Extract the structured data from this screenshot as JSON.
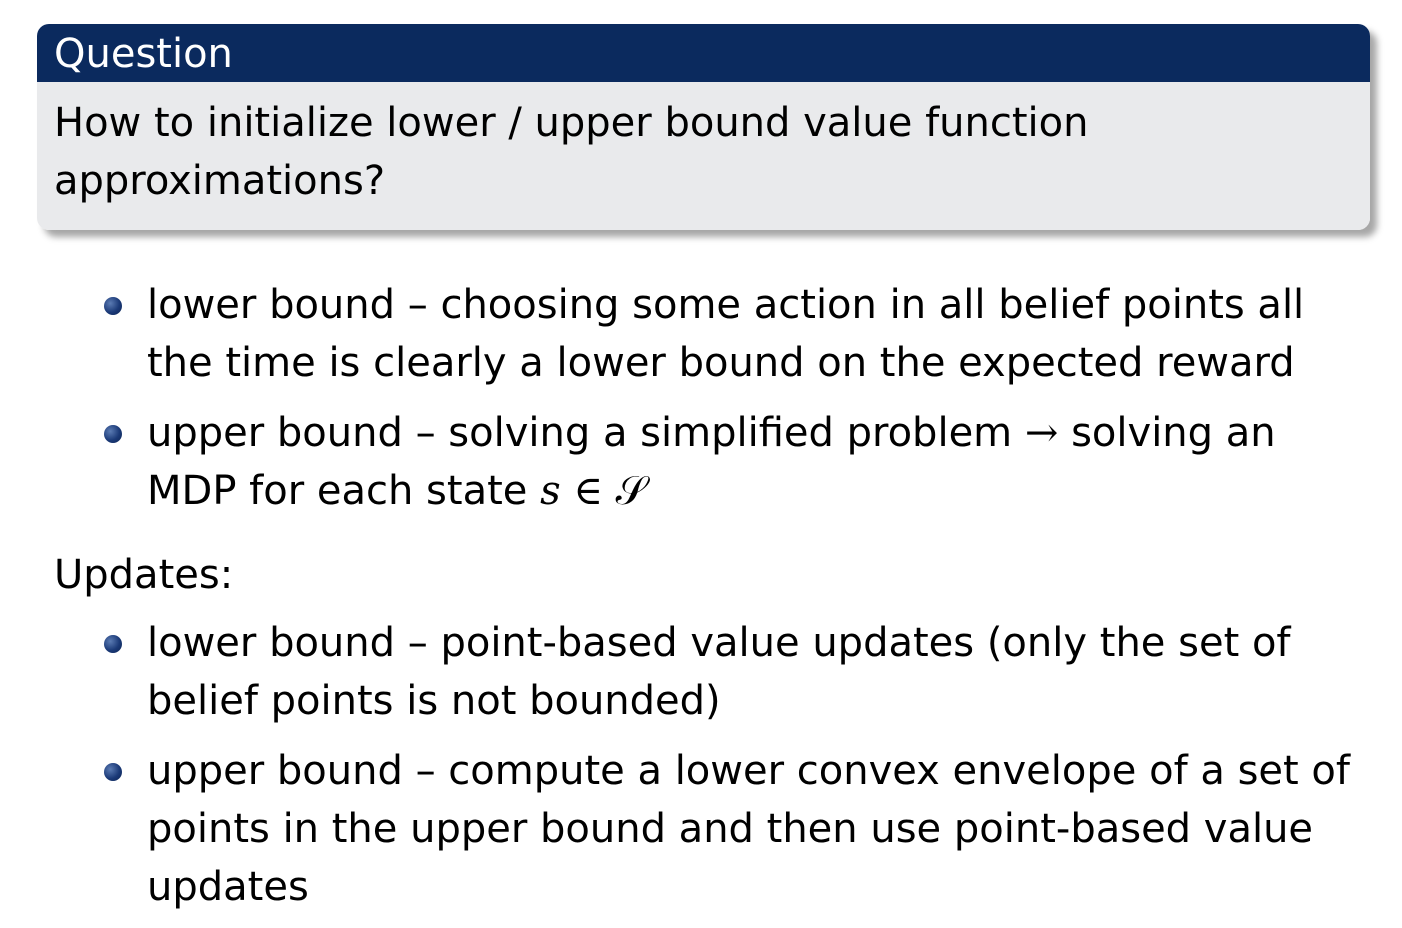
{
  "block": {
    "title": "Question",
    "body": "How to initialize lower / upper bound value function approximations?"
  },
  "init_items": [
    {
      "text": "lower bound – choosing some action in all belief points all the time is clearly a lower bound on the expected reward"
    },
    {
      "text_before": "upper bound – solving a simplified problem ",
      "arrow": "→",
      "text_after": " solving an MDP for each state ",
      "math_var": "s",
      "math_in": " ∈ ",
      "math_set": "𝒮"
    }
  ],
  "updates_label": "Updates:",
  "update_items": [
    {
      "text": "lower bound – point-based value updates (only the set of belief points is not bounded)"
    },
    {
      "text": "upper bound – compute a lower convex envelope of a set of points in the upper bound and then use point-based value updates"
    }
  ],
  "colors": {
    "block_title_bg": "#0b2a5e",
    "block_body_bg": "#e9eaec",
    "bullet": "#1b3a78"
  }
}
